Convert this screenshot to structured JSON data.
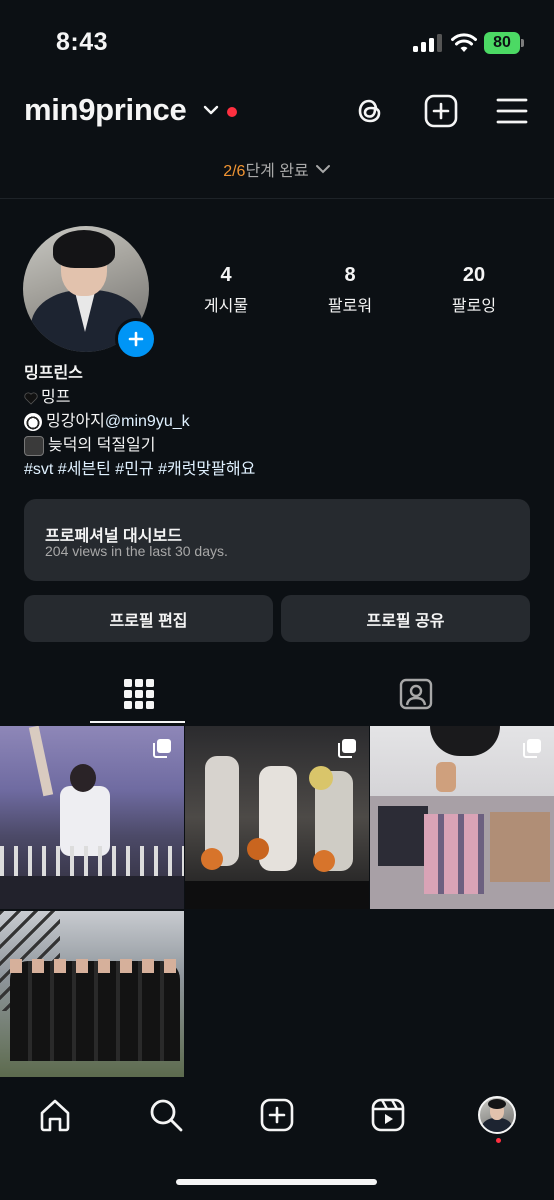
{
  "status_bar": {
    "time": "8:43",
    "battery": "80"
  },
  "header": {
    "username": "min9prince",
    "icons": [
      "threads-icon",
      "plus-square-icon",
      "menu-icon"
    ],
    "steps_done": "2/6",
    "steps_text": "단계 완료"
  },
  "profile": {
    "stats": [
      {
        "value": "4",
        "label": "게시물"
      },
      {
        "value": "8",
        "label": "팔로워"
      },
      {
        "value": "20",
        "label": "팔로잉"
      }
    ],
    "display_name": "밍프린스",
    "bio_line1": "밍프",
    "bio_line2_text": "밍강아지 ",
    "bio_line2_link": "@min9yu_k",
    "bio_line3": "늦덕의 덕질일기",
    "hashtags": "#svt #세븐틴 #민규 #캐럿맞팔해요"
  },
  "dashboard": {
    "title": "프로페셔널 대시보드",
    "subtitle": "204 views in the last 30 days."
  },
  "buttons": {
    "edit": "프로필 편집",
    "share": "프로필 공유"
  },
  "tabs": [
    "grid-icon",
    "tagged-icon"
  ],
  "posts": [
    {
      "desc": "concert-photo-waving",
      "multi": true
    },
    {
      "desc": "concert-photo-basketball",
      "multi": true
    },
    {
      "desc": "merch-collection",
      "multi": true
    },
    {
      "desc": "group-photo",
      "multi": false
    }
  ],
  "bottom_nav": [
    "home-icon",
    "search-icon",
    "create-icon",
    "reels-icon",
    "profile-avatar"
  ]
}
